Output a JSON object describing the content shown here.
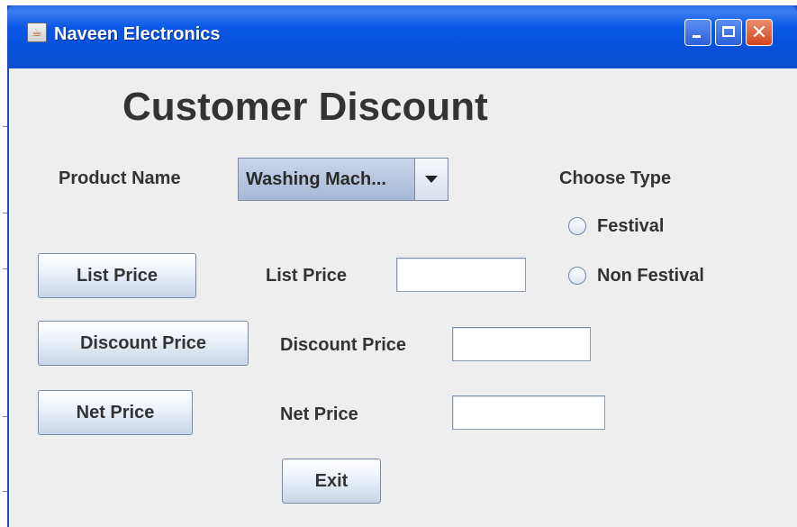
{
  "window": {
    "title": "Naveen Electronics",
    "icon": "java-coffee-icon",
    "controls": [
      "minimize-icon",
      "maximize-icon",
      "close-icon"
    ],
    "close_glyph": "✕"
  },
  "heading": "Customer Discount",
  "product": {
    "label": "Product Name",
    "selected": "Washing Mach..."
  },
  "choose_type": {
    "label": "Choose Type",
    "options": [
      "Festival",
      "Non Festival"
    ]
  },
  "buttons": {
    "list_price": "List Price",
    "discount_price": "Discount Price",
    "net_price": "Net Price",
    "exit": "Exit"
  },
  "fields": {
    "list_price_label": "List Price",
    "list_price_value": "",
    "discount_price_label": "Discount Price",
    "discount_price_value": "",
    "net_price_label": "Net Price",
    "net_price_value": ""
  },
  "colors": {
    "titlebar": "#0750d8",
    "client_bg": "#eeeeee",
    "close_button": "#d2451e"
  }
}
